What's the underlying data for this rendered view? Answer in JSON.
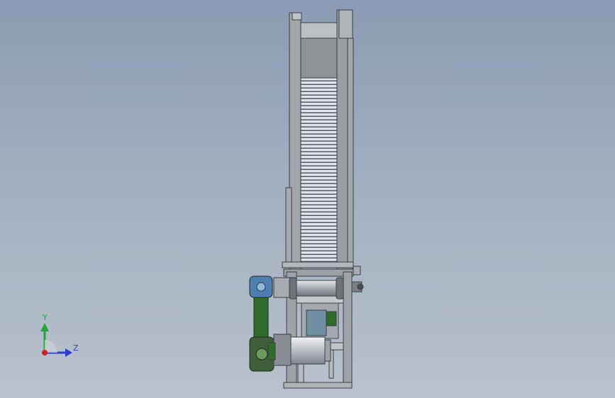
{
  "viewport": {
    "background_top": "#8a9bb3",
    "background_bottom": "#b9c2cc"
  },
  "model": {
    "description_icon": "machine-assembly-icon",
    "colors": {
      "frame": "#9ea1a6",
      "frame_edge": "#3c3f44",
      "slats": "#d4d7dc",
      "belt": "#2f6b2a",
      "pulley": "#4e7fb0",
      "motor": "#c9ccd1"
    }
  },
  "triad": {
    "y_label": "Y",
    "z_label": "Z",
    "y_color": "#22a63a",
    "z_color": "#2a3fcf",
    "x_color": "#d02020"
  }
}
